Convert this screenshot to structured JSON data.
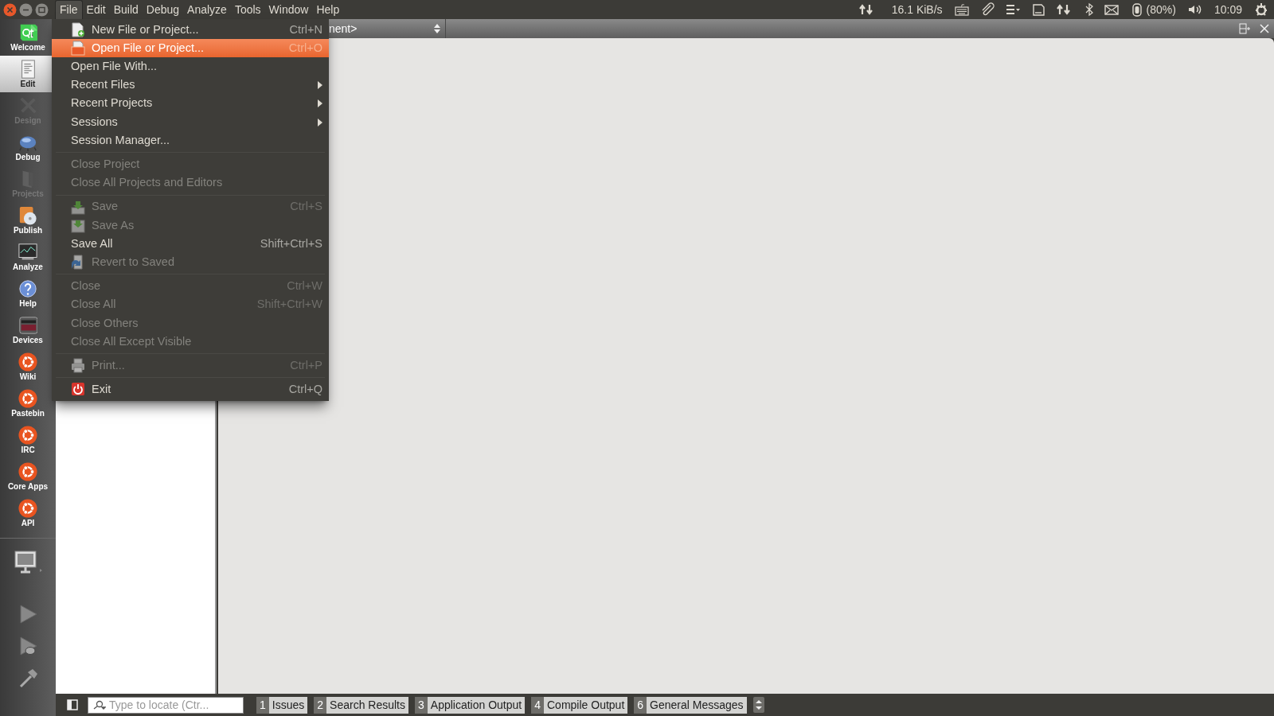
{
  "menubar": {
    "items": [
      {
        "label": "File",
        "selected": true
      },
      {
        "label": "Edit",
        "selected": false
      },
      {
        "label": "Build",
        "selected": false
      },
      {
        "label": "Debug",
        "selected": false
      },
      {
        "label": "Analyze",
        "selected": false
      },
      {
        "label": "Tools",
        "selected": false
      },
      {
        "label": "Window",
        "selected": false
      },
      {
        "label": "Help",
        "selected": false
      }
    ]
  },
  "indicators": {
    "network_speed": "16.1 KiB/s",
    "battery": "(80%)",
    "clock": "10:09"
  },
  "toolbar": {
    "document_combo": "nent>"
  },
  "file_menu": {
    "items": [
      {
        "kind": "item",
        "label": "New File or Project...",
        "shortcut": "Ctrl+N",
        "disabled": false,
        "selected": false,
        "submenu": false
      },
      {
        "kind": "item",
        "label": "Open File or Project...",
        "shortcut": "Ctrl+O",
        "disabled": false,
        "selected": true,
        "submenu": false
      },
      {
        "kind": "item",
        "label": "Open File With...",
        "disabled": false,
        "selected": false,
        "submenu": false
      },
      {
        "kind": "item",
        "label": "Recent Files",
        "disabled": false,
        "selected": false,
        "submenu": true
      },
      {
        "kind": "item",
        "label": "Recent Projects",
        "disabled": false,
        "selected": false,
        "submenu": true
      },
      {
        "kind": "item",
        "label": "Sessions",
        "disabled": false,
        "selected": false,
        "submenu": true
      },
      {
        "kind": "item",
        "label": "Session Manager...",
        "disabled": false,
        "selected": false,
        "submenu": false
      },
      {
        "kind": "separator"
      },
      {
        "kind": "item",
        "label": "Close Project",
        "disabled": true,
        "selected": false,
        "submenu": false
      },
      {
        "kind": "item",
        "label": "Close All Projects and Editors",
        "disabled": true,
        "selected": false,
        "submenu": false
      },
      {
        "kind": "separator"
      },
      {
        "kind": "item",
        "label": "Save",
        "shortcut": "Ctrl+S",
        "disabled": true,
        "selected": false,
        "submenu": false
      },
      {
        "kind": "item",
        "label": "Save As",
        "disabled": true,
        "selected": false,
        "submenu": false
      },
      {
        "kind": "item",
        "label": "Save All",
        "shortcut": "Shift+Ctrl+S",
        "disabled": false,
        "selected": false,
        "submenu": false
      },
      {
        "kind": "item",
        "label": "Revert to Saved",
        "disabled": true,
        "selected": false,
        "submenu": false
      },
      {
        "kind": "separator"
      },
      {
        "kind": "item",
        "label": "Close",
        "shortcut": "Ctrl+W",
        "disabled": true,
        "selected": false,
        "submenu": false
      },
      {
        "kind": "item",
        "label": "Close All",
        "shortcut": "Shift+Ctrl+W",
        "disabled": true,
        "selected": false,
        "submenu": false
      },
      {
        "kind": "item",
        "label": "Close Others",
        "disabled": true,
        "selected": false,
        "submenu": false
      },
      {
        "kind": "item",
        "label": "Close All Except Visible",
        "disabled": true,
        "selected": false,
        "submenu": false
      },
      {
        "kind": "separator"
      },
      {
        "kind": "item",
        "label": "Print...",
        "shortcut": "Ctrl+P",
        "disabled": true,
        "selected": false,
        "submenu": false
      },
      {
        "kind": "separator"
      },
      {
        "kind": "item",
        "label": "Exit",
        "shortcut": "Ctrl+Q",
        "disabled": false,
        "selected": false,
        "submenu": false
      }
    ]
  },
  "mode_bar": {
    "items": [
      {
        "label": "Welcome",
        "selected": false,
        "disabled": false
      },
      {
        "label": "Edit",
        "selected": true,
        "disabled": false
      },
      {
        "label": "Design",
        "selected": false,
        "disabled": true
      },
      {
        "label": "Debug",
        "selected": false,
        "disabled": false
      },
      {
        "label": "Projects",
        "selected": false,
        "disabled": true
      },
      {
        "label": "Publish",
        "selected": false,
        "disabled": false
      },
      {
        "label": "Analyze",
        "selected": false,
        "disabled": false
      },
      {
        "label": "Help",
        "selected": false,
        "disabled": false
      },
      {
        "label": "Devices",
        "selected": false,
        "disabled": false
      },
      {
        "label": "Wiki",
        "selected": false,
        "disabled": false
      },
      {
        "label": "Pastebin",
        "selected": false,
        "disabled": false
      },
      {
        "label": "IRC",
        "selected": false,
        "disabled": false
      },
      {
        "label": "Core Apps",
        "selected": false,
        "disabled": false
      },
      {
        "label": "API",
        "selected": false,
        "disabled": false
      }
    ]
  },
  "status_bar": {
    "locator": {
      "placeholder": "Type to locate (Ctr..."
    },
    "panes": [
      {
        "number": "1",
        "label": "Issues"
      },
      {
        "number": "2",
        "label": "Search Results"
      },
      {
        "number": "3",
        "label": "Application Output"
      },
      {
        "number": "4",
        "label": "Compile Output"
      },
      {
        "number": "6",
        "label": "General Messages"
      }
    ]
  }
}
